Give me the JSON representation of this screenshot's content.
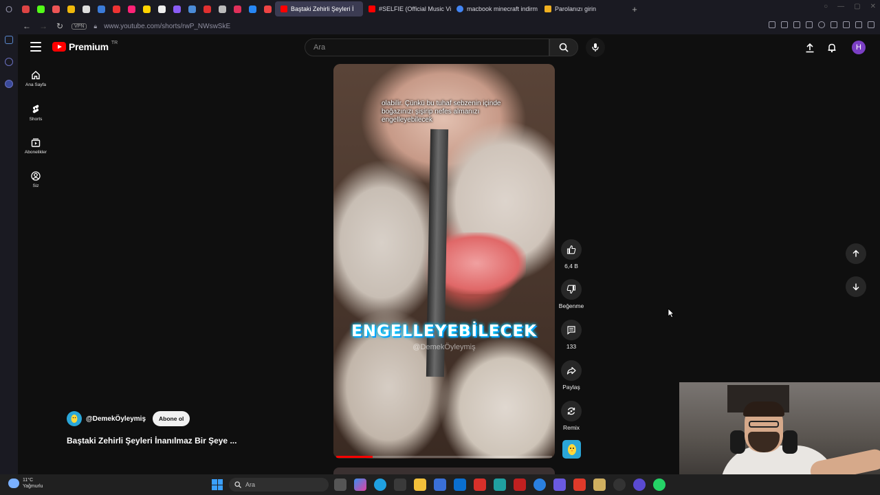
{
  "browser": {
    "tabs": [
      {
        "label": "Baştaki Zehirli Şeyleri İ",
        "active": true,
        "color": "#ff0000"
      },
      {
        "label": "#SELFIE (Official Music Vi",
        "active": false,
        "color": "#ff0000"
      },
      {
        "label": "macbook minecraft indirm",
        "active": false,
        "color": "#4285f4"
      },
      {
        "label": "Parolanızı girin",
        "active": false,
        "color": "#f0b020"
      }
    ],
    "vpn_label": "VPN",
    "url": "www.youtube.com/shorts/rwP_NWswSkE"
  },
  "youtube": {
    "logo_text": "Premium",
    "logo_region": "TR",
    "search_placeholder": "Ara",
    "avatar_letter": "H",
    "nav": [
      {
        "label": "Ana Sayfa",
        "icon": "home-icon"
      },
      {
        "label": "Shorts",
        "icon": "shorts-icon"
      },
      {
        "label": "Abonelikler",
        "icon": "subscriptions-icon"
      },
      {
        "label": "Siz",
        "icon": "you-icon"
      }
    ]
  },
  "short": {
    "subtitle_lines": [
      "olabilir. Çünkü bu tuhaf sebzenin içinde",
      "boğazınızı şişirip nefes almanızı",
      "engelleyebilecek"
    ],
    "caption": "ENGELLEYEBİLECEK",
    "watermark": "@DemekÖyleymiş",
    "progress": 0.17,
    "channel_name": "@DemekÖyleymiş",
    "subscribe_label": "Abone ol",
    "title": "Baştaki Zehirli Şeyleri İnanılmaz Bir Şeye ..."
  },
  "actions": {
    "like_count": "6,4 B",
    "dislike_label": "Beğenme",
    "comment_count": "133",
    "share_label": "Paylaş",
    "remix_label": "Remix"
  },
  "taskbar": {
    "temperature": "11°C",
    "weather_text": "Yağmurlu",
    "search_placeholder": "Ara"
  }
}
